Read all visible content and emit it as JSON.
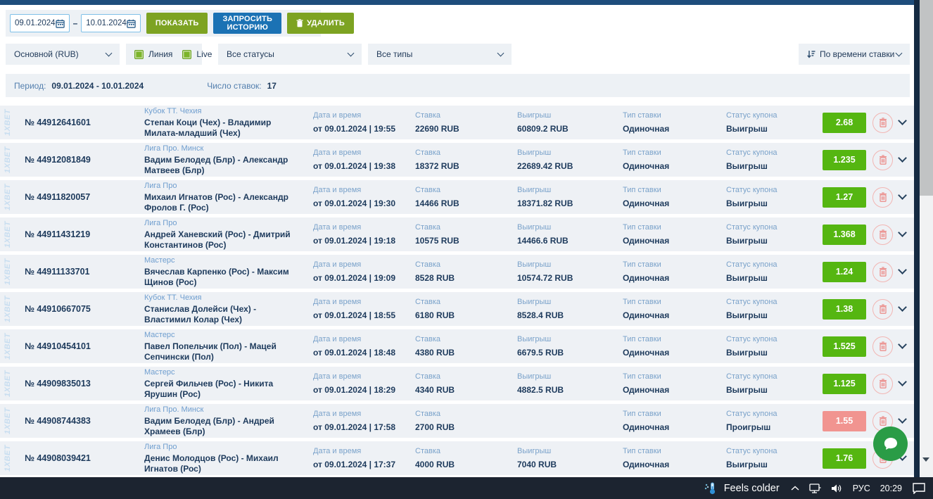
{
  "colors": {
    "accent_green": "#7da322",
    "accent_blue": "#1b72b4",
    "badge_win": "#55b611",
    "badge_loss": "#f19490",
    "top_bar": "#1e4d7c"
  },
  "toolbar": {
    "date_from": "09.01.2024",
    "date_to": "10.01.2024",
    "separator": "–",
    "show_button": "ПОКАЗАТЬ",
    "request_button": "ЗАПРОСИТЬ ИСТОРИЮ",
    "delete_button": "УДАЛИТЬ"
  },
  "filters": {
    "account": "Основной (RUB)",
    "line_label": "Линия",
    "live_label": "Live",
    "statuses": "Все статусы",
    "types": "Все типы",
    "sort": "По времени ставки"
  },
  "summary": {
    "period_label": "Период:",
    "period_value": "09.01.2024 - 10.01.2024",
    "count_label": "Число ставок:",
    "count_value": "17"
  },
  "table": {
    "watermark": "1XBET",
    "labels": {
      "date": "Дата и время",
      "stake": "Ставка",
      "win": "Выигрыш",
      "type": "Тип ставки",
      "status": "Статус купона"
    },
    "rows": [
      {
        "id": "№ 44912641601",
        "league": "Кубок ТТ. Чехия",
        "match": "Степан Коци (Чех) - Владимир Милата-младший (Чех)",
        "date": "от 09.01.2024 | 19:55",
        "stake": "22690 RUB",
        "win": "60809.2 RUB",
        "type": "Одиночная",
        "status": "Выигрыш",
        "coef": "2.68",
        "won": true
      },
      {
        "id": "№ 44912081849",
        "league": "Лига Про. Минск",
        "match": "Вадим Белодед (Блр) - Александр Матвеев (Блр)",
        "date": "от 09.01.2024 | 19:38",
        "stake": "18372 RUB",
        "win": "22689.42 RUB",
        "type": "Одиночная",
        "status": "Выигрыш",
        "coef": "1.235",
        "won": true
      },
      {
        "id": "№ 44911820057",
        "league": "Лига Про",
        "match": "Михаил Игнатов (Рос) - Александр Фролов Г. (Рос)",
        "date": "от 09.01.2024 | 19:30",
        "stake": "14466 RUB",
        "win": "18371.82 RUB",
        "type": "Одиночная",
        "status": "Выигрыш",
        "coef": "1.27",
        "won": true
      },
      {
        "id": "№ 44911431219",
        "league": "Лига Про",
        "match": "Андрей Ханевский (Рос) - Дмитрий Константинов (Рос)",
        "date": "от 09.01.2024 | 19:18",
        "stake": "10575 RUB",
        "win": "14466.6 RUB",
        "type": "Одиночная",
        "status": "Выигрыш",
        "coef": "1.368",
        "won": true
      },
      {
        "id": "№ 44911133701",
        "league": "Мастерс",
        "match": "Вячеслав Карпенко (Рос) - Максим Щинов (Рос)",
        "date": "от 09.01.2024 | 19:09",
        "stake": "8528 RUB",
        "win": "10574.72 RUB",
        "type": "Одиночная",
        "status": "Выигрыш",
        "coef": "1.24",
        "won": true
      },
      {
        "id": "№ 44910667075",
        "league": "Кубок ТТ. Чехия",
        "match": "Станислав Долейси (Чех) - Властимил Колар (Чех)",
        "date": "от 09.01.2024 | 18:55",
        "stake": "6180 RUB",
        "win": "8528.4 RUB",
        "type": "Одиночная",
        "status": "Выигрыш",
        "coef": "1.38",
        "won": true
      },
      {
        "id": "№ 44910454101",
        "league": "Мастерс",
        "match": "Павел Попельчик (Пол) - Мацей Сепчински (Пол)",
        "date": "от 09.01.2024 | 18:48",
        "stake": "4380 RUB",
        "win": "6679.5 RUB",
        "type": "Одиночная",
        "status": "Выигрыш",
        "coef": "1.525",
        "won": true
      },
      {
        "id": "№ 44909835013",
        "league": "Мастерс",
        "match": "Сергей Фильчев (Рос) - Никита Ярушин (Рос)",
        "date": "от 09.01.2024 | 18:29",
        "stake": "4340 RUB",
        "win": "4882.5 RUB",
        "type": "Одиночная",
        "status": "Выигрыш",
        "coef": "1.125",
        "won": true
      },
      {
        "id": "№ 44908744383",
        "league": "Лига Про. Минск",
        "match": "Вадим Белодед (Блр) - Андрей Храмеев (Блр)",
        "date": "от 09.01.2024 | 17:58",
        "stake": "2700 RUB",
        "win": "",
        "type": "Одиночная",
        "status": "Проигрыш",
        "coef": "1.55",
        "won": false
      },
      {
        "id": "№ 44908039421",
        "league": "Лига Про",
        "match": "Денис Молодцов (Рос) - Михаил Игнатов (Рос)",
        "date": "от 09.01.2024 | 17:37",
        "stake": "4000 RUB",
        "win": "7040 RUB",
        "type": "Одиночная",
        "status": "Выигрыш",
        "coef": "1.76",
        "won": true
      }
    ]
  },
  "taskbar": {
    "weather": "Feels colder",
    "language": "РУС",
    "time": "20:29"
  }
}
